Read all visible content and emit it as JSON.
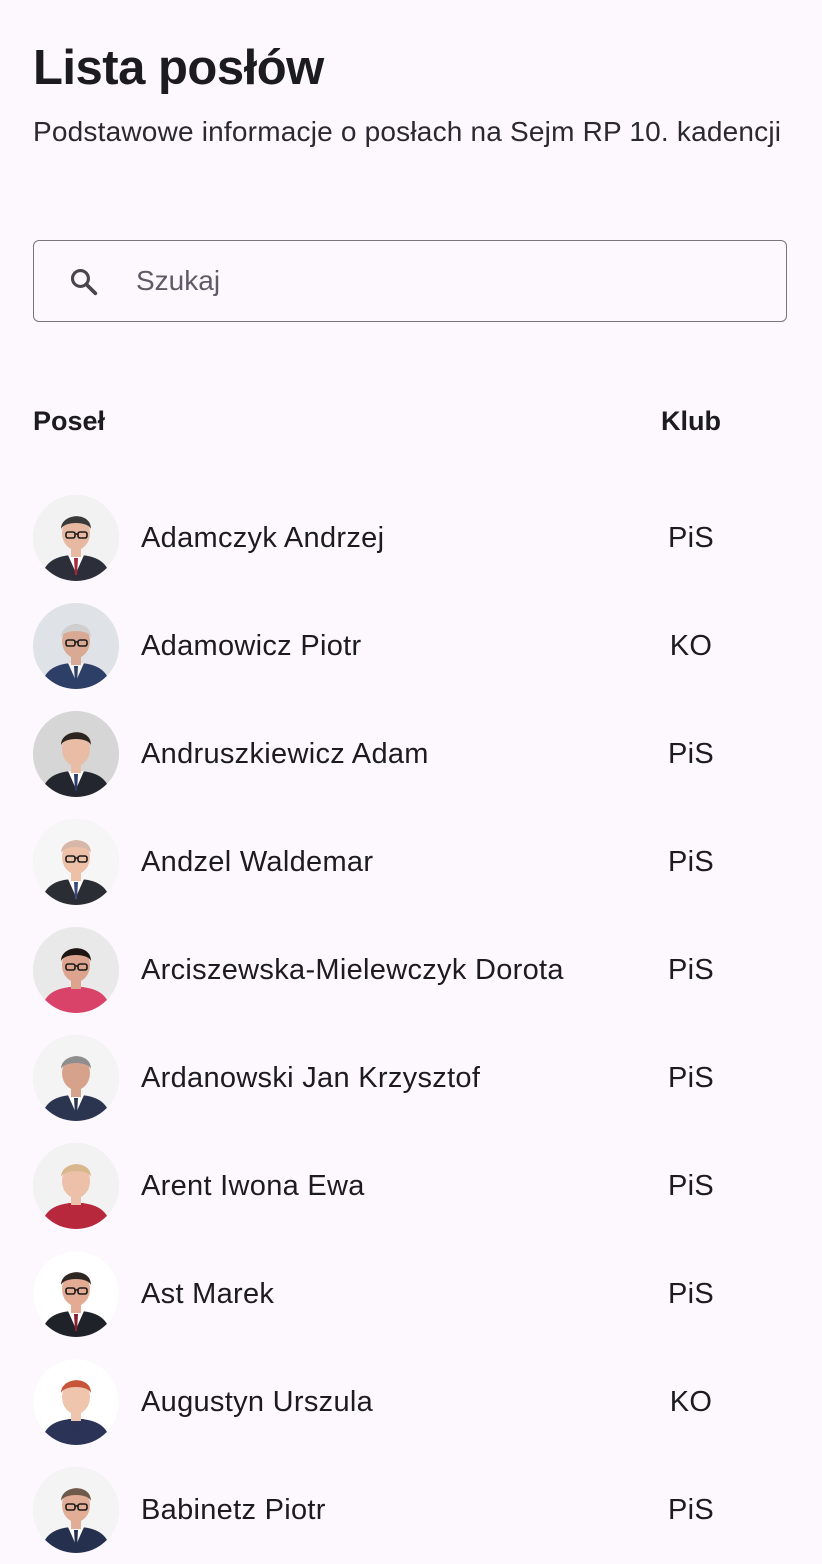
{
  "header": {
    "title": "Lista posłów",
    "subtitle": "Podstawowe informacje o posłach na Sejm RP 10. kadencji"
  },
  "search": {
    "placeholder": "Szukaj",
    "value": "",
    "icon": "search-icon"
  },
  "table": {
    "columns": {
      "name": "Poseł",
      "club": "Klub"
    },
    "rows": [
      {
        "name": "Adamczyk Andrzej",
        "club": "PiS",
        "avatar": {
          "bg": "#f2f2f2",
          "hair": "#3a3a3a",
          "skin": "#e7b9a2",
          "suit": "#2c2f3a",
          "shirt": "#ffffff",
          "tie": "#a8263a",
          "glasses": true
        }
      },
      {
        "name": "Adamowicz Piotr",
        "club": "KO",
        "avatar": {
          "bg": "#dfe3e8",
          "hair": "#cfcfcf",
          "skin": "#d9a994",
          "suit": "#2d3f66",
          "shirt": "#f4f4f4",
          "tie": "#2d3f66",
          "glasses": true
        }
      },
      {
        "name": "Andruszkiewicz Adam",
        "club": "PiS",
        "avatar": {
          "bg": "#d6d6d6",
          "hair": "#2b2420",
          "skin": "#e8bca5",
          "suit": "#23262e",
          "shirt": "#ffffff",
          "tie": "#2a3b6b",
          "glasses": false
        }
      },
      {
        "name": "Andzel Waldemar",
        "club": "PiS",
        "avatar": {
          "bg": "#f6f6f6",
          "hair": "#d7b8a8",
          "skin": "#eec0a8",
          "suit": "#2b2d34",
          "shirt": "#ffffff",
          "tie": "#3b4a7a",
          "glasses": true
        }
      },
      {
        "name": "Arciszewska-Mielewczyk Dorota",
        "club": "PiS",
        "avatar": {
          "bg": "#e9e9e9",
          "hair": "#1d1513",
          "skin": "#dca48e",
          "suit": "#d9436a",
          "shirt": "#d9436a",
          "tie": "#d9436a",
          "glasses": true
        }
      },
      {
        "name": "Ardanowski Jan Krzysztof",
        "club": "PiS",
        "avatar": {
          "bg": "#f4f4f4",
          "hair": "#8e8e8e",
          "skin": "#d7a28c",
          "suit": "#2c3550",
          "shirt": "#ffffff",
          "tie": "#2c3550",
          "glasses": false
        }
      },
      {
        "name": "Arent Iwona Ewa",
        "club": "PiS",
        "avatar": {
          "bg": "#f2f2f2",
          "hair": "#d9b78c",
          "skin": "#edc0a9",
          "suit": "#b7283d",
          "shirt": "#b7283d",
          "tie": "#b7283d",
          "glasses": false
        }
      },
      {
        "name": "Ast Marek",
        "club": "PiS",
        "avatar": {
          "bg": "#ffffff",
          "hair": "#2e2622",
          "skin": "#e3ab94",
          "suit": "#1f2229",
          "shirt": "#ffffff",
          "tie": "#8b1e2a",
          "glasses": true
        }
      },
      {
        "name": "Augustyn Urszula",
        "club": "KO",
        "avatar": {
          "bg": "#ffffff",
          "hair": "#c8553a",
          "skin": "#efc5ae",
          "suit": "#2b3357",
          "shirt": "#2b3357",
          "tie": "#2b3357",
          "glasses": false
        }
      },
      {
        "name": "Babinetz Piotr",
        "club": "PiS",
        "avatar": {
          "bg": "#f4f4f4",
          "hair": "#6d5a4a",
          "skin": "#e2ad96",
          "suit": "#25304f",
          "shirt": "#ffffff",
          "tie": "#25304f",
          "glasses": true
        }
      }
    ]
  }
}
